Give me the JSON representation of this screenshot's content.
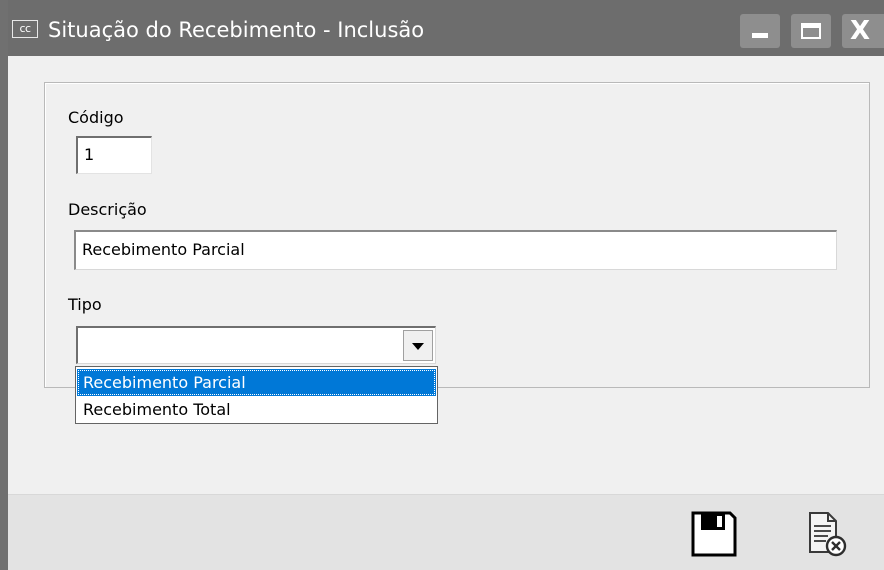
{
  "window": {
    "app_icon_text": "cc",
    "title": "Situação do Recebimento - Inclusão",
    "minimize_icon": "minimize-icon",
    "maximize_icon": "maximize-icon",
    "close_icon": "close-icon",
    "close_glyph": "X"
  },
  "form": {
    "codigo_label": "Código",
    "codigo_value": "1",
    "descricao_label": "Descrição",
    "descricao_value": "Recebimento Parcial",
    "tipo_label": "Tipo",
    "tipo_selected": "",
    "tipo_options": [
      "Recebimento Parcial",
      "Recebimento Total"
    ],
    "tipo_highlighted_index": 0
  },
  "footer": {
    "save_icon": "floppy-disk-icon",
    "cancel_icon": "document-cancel-icon"
  },
  "colors": {
    "titlebar": "#6d6d6d",
    "selection": "#0078d7",
    "background": "#f0f0f0"
  }
}
